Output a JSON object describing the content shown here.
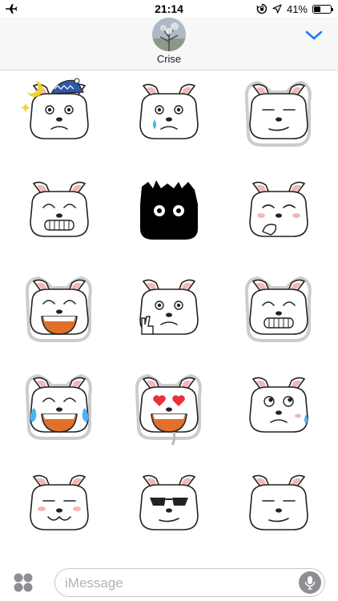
{
  "status_bar": {
    "time": "21:14",
    "battery_percent": "41%",
    "battery_level": 0.41,
    "icons": [
      "airplane-icon",
      "rotation-lock-icon",
      "location-arrow-icon",
      "battery-icon"
    ]
  },
  "header": {
    "contact_name": "Crise",
    "avatar": "avatar-photo",
    "collapse_icon": "chevron-down-icon",
    "accent_color": "#1a7cf4"
  },
  "stickers": [
    {
      "name": "sticker-sleepy-nightcap-dog",
      "mood": "sleepy"
    },
    {
      "name": "sticker-worried-dog",
      "mood": "worried"
    },
    {
      "name": "sticker-smirk-dog",
      "mood": "smirk"
    },
    {
      "name": "sticker-grin-dog",
      "mood": "grin"
    },
    {
      "name": "sticker-black-silhouette-dog",
      "mood": "black"
    },
    {
      "name": "sticker-shy-dog",
      "mood": "shy"
    },
    {
      "name": "sticker-laughing-dog",
      "mood": "laugh"
    },
    {
      "name": "sticker-peace-sign-dog",
      "mood": "peace"
    },
    {
      "name": "sticker-happy-grin-dog",
      "mood": "happygrin"
    },
    {
      "name": "sticker-tears-of-joy-dog",
      "mood": "tears"
    },
    {
      "name": "sticker-heart-eyes-dog",
      "mood": "hearts"
    },
    {
      "name": "sticker-nervous-dog",
      "mood": "nervous"
    },
    {
      "name": "sticker-content-dog",
      "mood": "content"
    },
    {
      "name": "sticker-sunglasses-dog",
      "mood": "cool"
    },
    {
      "name": "sticker-unamused-dog",
      "mood": "unamused"
    }
  ],
  "compose": {
    "apps_icon": "app-drawer-icon",
    "placeholder": "iMessage",
    "value": "",
    "mic_icon": "microphone-icon"
  }
}
